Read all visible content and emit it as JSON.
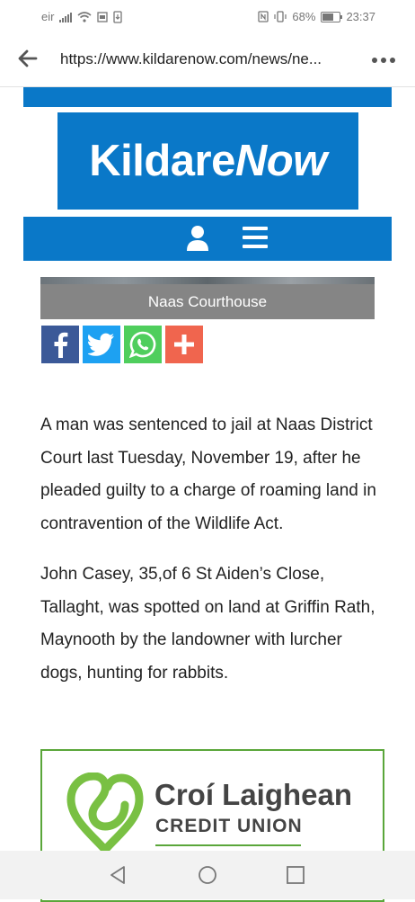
{
  "status_bar": {
    "carrier": "eir",
    "battery": "68%",
    "time": "23:37"
  },
  "browser": {
    "url": "https://www.kildarenow.com/news/ne...",
    "icons": [
      "back-arrow-icon",
      "more-options-icon"
    ]
  },
  "site": {
    "logo_part1": "Kildare",
    "logo_part2": "Now",
    "brand_color": "#0a78c8",
    "nav_icons": [
      "user-icon",
      "menu-icon"
    ]
  },
  "article": {
    "photo_caption": "Naas Courthouse",
    "share_buttons": [
      {
        "name": "facebook",
        "color": "#3b5998"
      },
      {
        "name": "twitter",
        "color": "#1da1f2"
      },
      {
        "name": "whatsapp",
        "color": "#4fce5d"
      },
      {
        "name": "more",
        "color": "#f0654e"
      }
    ],
    "paragraphs": [
      "A man was sentenced to jail at Naas District Court last Tuesday, November 19, after he pleaded guilty to a charge of roaming land in contravention of the Wildlife Act.",
      "John Casey, 35,of 6 St Aiden’s Close, Tallaght, was spotted on land at Griffin Rath, Maynooth by the landowner with lurcher dogs, hunting for rabbits."
    ]
  },
  "ad": {
    "title": "Croí Laighean",
    "subtitle": "CREDIT UNION",
    "accent": "#5aa63a"
  }
}
